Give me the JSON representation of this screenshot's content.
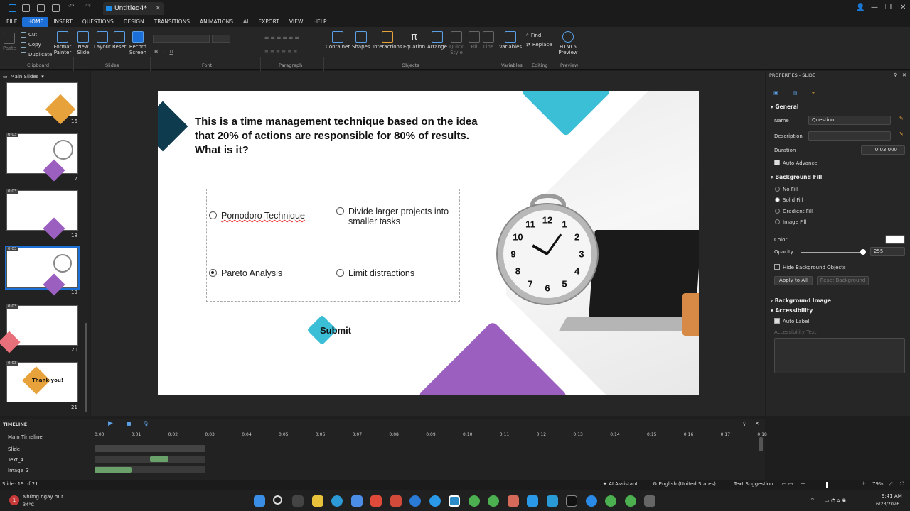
{
  "app": {
    "doc_tab": "Untitled4*"
  },
  "menu": [
    "FILE",
    "HOME",
    "INSERT",
    "QUESTIONS",
    "DESIGN",
    "TRANSITIONS",
    "ANIMATIONS",
    "AI",
    "EXPORT",
    "VIEW",
    "HELP"
  ],
  "ribbon": {
    "paste": "Paste",
    "cut": "Cut",
    "copy": "Copy",
    "duplicate": "Duplicate",
    "format_painter": "Format Painter",
    "new_slide": "New Slide",
    "layout": "Layout",
    "reset": "Reset",
    "record_screen": "Record Screen",
    "container": "Container",
    "shapes": "Shapes",
    "interactions": "Interactions",
    "equation": "Equation",
    "arrange": "Arrange",
    "quick_style": "Quick Style",
    "fill": "Fill",
    "line": "Line",
    "variables": "Variables",
    "find": "Find",
    "replace": "Replace",
    "html5_preview": "HTML5 Preview",
    "groups": {
      "clipboard": "Clipboard",
      "slides": "Slides",
      "font": "Font",
      "paragraph": "Paragraph",
      "objects": "Objects",
      "variables": "Variables",
      "editing": "Editing",
      "preview": "Preview"
    }
  },
  "slides_panel": {
    "title": "Main Slides",
    "thumbs": [
      {
        "num": "16",
        "dur": ""
      },
      {
        "num": "17",
        "dur": "0:03"
      },
      {
        "num": "18",
        "dur": "0:03"
      },
      {
        "num": "19",
        "dur": "0:03"
      },
      {
        "num": "20",
        "dur": "0:03"
      },
      {
        "num": "21",
        "dur": "0:03"
      }
    ],
    "thankyou": "Thank you!"
  },
  "slide": {
    "question": "This is a time management technique based on the idea that 20% of actions are responsible for 80% of results. What is it?",
    "options": [
      {
        "label": "Pomodoro Technique",
        "selected": false
      },
      {
        "label": "Divide larger projects into smaller tasks",
        "selected": false
      },
      {
        "label": "Pareto Analysis",
        "selected": true
      },
      {
        "label": "Limit distractions",
        "selected": false
      }
    ],
    "submit": "Submit",
    "clock_numbers": [
      "12",
      "1",
      "2",
      "3",
      "4",
      "5",
      "6",
      "7",
      "8",
      "9",
      "10",
      "11"
    ]
  },
  "properties": {
    "title": "PROPERTIES - SLIDE",
    "general": "General",
    "name_label": "Name",
    "name_value": "Question",
    "description_label": "Description",
    "duration_label": "Duration",
    "duration_value": "0:03.000",
    "auto_advance": "Auto Advance",
    "background_fill": "Background Fill",
    "no_fill": "No Fill",
    "solid_fill": "Solid Fill",
    "gradient_fill": "Gradient Fill",
    "image_fill": "Image Fill",
    "color_label": "Color",
    "opacity_label": "Opacity",
    "opacity_value": "255",
    "hide_bg": "Hide Background Objects",
    "apply_all": "Apply to All",
    "reset_bg": "Reset Background",
    "background_image": "Background Image",
    "accessibility": "Accessibility",
    "auto_label": "Auto Label",
    "accessibility_text": "Accessibility Text"
  },
  "timeline": {
    "title": "TIMELINE",
    "main": "Main Timeline",
    "ticks": [
      "0:00",
      "0:01",
      "0:02",
      "0:03",
      "0:04",
      "0:05",
      "0:06",
      "0:07",
      "0:08",
      "0:09",
      "0:10",
      "0:11",
      "0:12",
      "0:13",
      "0:14",
      "0:15",
      "0:16",
      "0:17",
      "0:18"
    ],
    "rows": [
      "Slide",
      "Text_4",
      "Image_3"
    ]
  },
  "status": {
    "slide": "Slide: 19 of 21",
    "ai": "AI Assistant",
    "lang": "English (United States)",
    "text_suggestion": "Text Suggestion",
    "zoom": "79%"
  },
  "taskbar": {
    "weather": "Những ngày mư...",
    "temp": "34°C",
    "time": "9:41 AM",
    "date": "6/23/2026",
    "badge": "1"
  },
  "colors": {
    "accent": "#1c6fd6",
    "teal": "#3bbfd6",
    "purple": "#9b5fc0",
    "navy": "#0f3b4f"
  }
}
